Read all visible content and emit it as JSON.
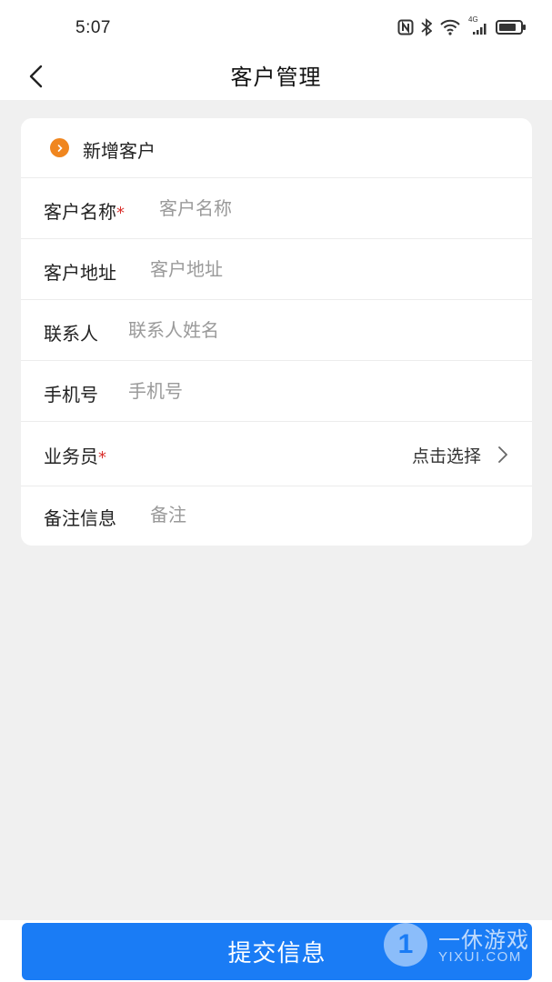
{
  "status_bar": {
    "time": "5:07",
    "network_label": "4G",
    "icons": [
      "nfc-icon",
      "bluetooth-icon",
      "wifi-icon",
      "signal-icon",
      "battery-icon"
    ]
  },
  "nav": {
    "title": "客户管理",
    "back_icon": "chevron-left-icon"
  },
  "form": {
    "section_title": "新增客户",
    "fields": [
      {
        "label": "客户名称",
        "required": true,
        "placeholder": "客户名称",
        "value": ""
      },
      {
        "label": "客户地址",
        "required": false,
        "placeholder": "客户地址",
        "value": ""
      },
      {
        "label": "联系人",
        "required": false,
        "placeholder": "联系人姓名",
        "value": ""
      },
      {
        "label": "手机号",
        "required": false,
        "placeholder": "手机号",
        "value": ""
      },
      {
        "label": "业务员",
        "required": true,
        "select_text": "点击选择"
      },
      {
        "label": "备注信息",
        "required": false,
        "placeholder": "备注",
        "value": ""
      }
    ],
    "required_mark": "*"
  },
  "submit": {
    "label": "提交信息"
  },
  "watermark": {
    "logo_text": "1",
    "name_cn": "一休游戏",
    "name_en": "YIXUI.COM"
  },
  "colors": {
    "accent": "#1a7cf5",
    "section_dot": "#f0861f",
    "required": "#d9302c",
    "background": "#f0f0f0"
  }
}
